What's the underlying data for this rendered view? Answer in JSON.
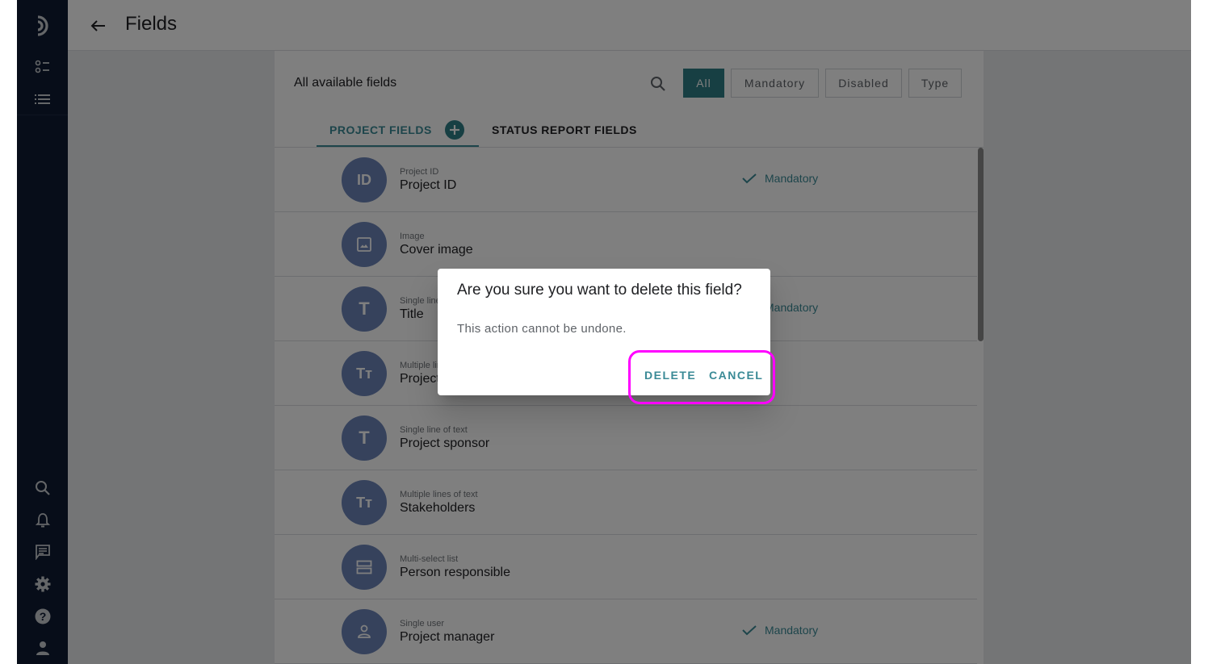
{
  "header": {
    "title": "Fields",
    "back_icon": "arrow-left-icon"
  },
  "sidebar": {
    "top_items": [
      {
        "icon": "logo-icon"
      },
      {
        "icon": "toggle-list-icon"
      },
      {
        "icon": "list-icon"
      }
    ],
    "bottom_items": [
      {
        "icon": "search-icon"
      },
      {
        "icon": "bell-icon"
      },
      {
        "icon": "chat-icon"
      },
      {
        "icon": "gear-icon"
      },
      {
        "icon": "help-icon"
      },
      {
        "icon": "user-icon"
      }
    ]
  },
  "panel": {
    "title": "All available fields",
    "filters": [
      "All",
      "Mandatory",
      "Disabled",
      "Type"
    ],
    "active_filter": "All",
    "tabs": [
      {
        "label": "PROJECT FIELDS",
        "active": true
      },
      {
        "label": "STATUS REPORT FIELDS",
        "active": false
      }
    ]
  },
  "fields": [
    {
      "avatar": "ID",
      "type": "Project ID",
      "name": "Project ID",
      "mandatory": "Mandatory"
    },
    {
      "avatar": "image-icon",
      "type": "Image",
      "name": "Cover image",
      "mandatory": null
    },
    {
      "avatar": "T",
      "type": "Single line of text",
      "name": "Title",
      "mandatory": "Mandatory"
    },
    {
      "avatar": "Tт",
      "type": "Multiple lines of text",
      "name": "Project description",
      "mandatory": null
    },
    {
      "avatar": "T",
      "type": "Single line of text",
      "name": "Project sponsor",
      "mandatory": null
    },
    {
      "avatar": "Tт",
      "type": "Multiple lines of text",
      "name": "Stakeholders",
      "mandatory": null
    },
    {
      "avatar": "list-icon",
      "type": "Multi-select list",
      "name": "Person responsible",
      "mandatory": null
    },
    {
      "avatar": "user-icon",
      "type": "Single user",
      "name": "Project manager",
      "mandatory": "Mandatory"
    }
  ],
  "dialog": {
    "title": "Are you sure you want to delete this field?",
    "body": "This action cannot be undone.",
    "delete_label": "DELETE",
    "cancel_label": "CANCEL"
  },
  "colors": {
    "accent": "#2f7e86",
    "highlight": "#ff00ff",
    "sidebar": "#0f1a33",
    "avatar": "#6c85b8"
  }
}
